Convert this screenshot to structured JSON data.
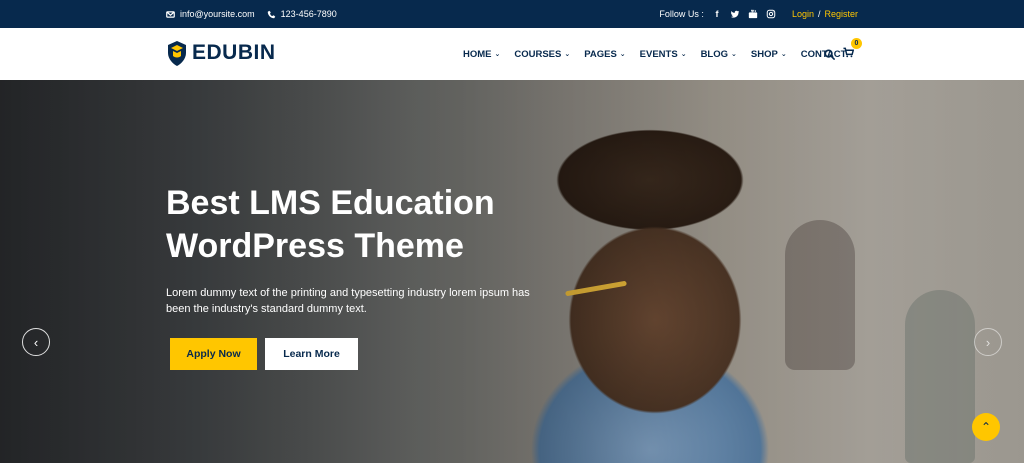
{
  "topbar": {
    "email": "info@yoursite.com",
    "phone": "123-456-7890",
    "follow_label": "Follow Us :",
    "social_icons": [
      "facebook-icon",
      "twitter-icon",
      "youtube-icon",
      "instagram-icon"
    ],
    "login": "Login",
    "separator": "/",
    "register": "Register"
  },
  "nav": {
    "logo_text": "EDUBIN",
    "items": [
      {
        "label": "HOME",
        "dropdown": true
      },
      {
        "label": "COURSES",
        "dropdown": true
      },
      {
        "label": "PAGES",
        "dropdown": true
      },
      {
        "label": "EVENTS",
        "dropdown": true
      },
      {
        "label": "BLOG",
        "dropdown": true
      },
      {
        "label": "SHOP",
        "dropdown": true
      },
      {
        "label": "CONTACT",
        "dropdown": false
      }
    ],
    "cart_count": "0"
  },
  "hero": {
    "title_line1": "Best LMS Education",
    "title_line2": "WordPress Theme",
    "description": "Lorem dummy text of the printing and typesetting industry lorem ipsum has been the industry's standard dummy text.",
    "apply_label": "Apply Now",
    "learn_label": "Learn More"
  },
  "colors": {
    "primary": "#07294d",
    "accent": "#ffc600",
    "white": "#ffffff"
  }
}
